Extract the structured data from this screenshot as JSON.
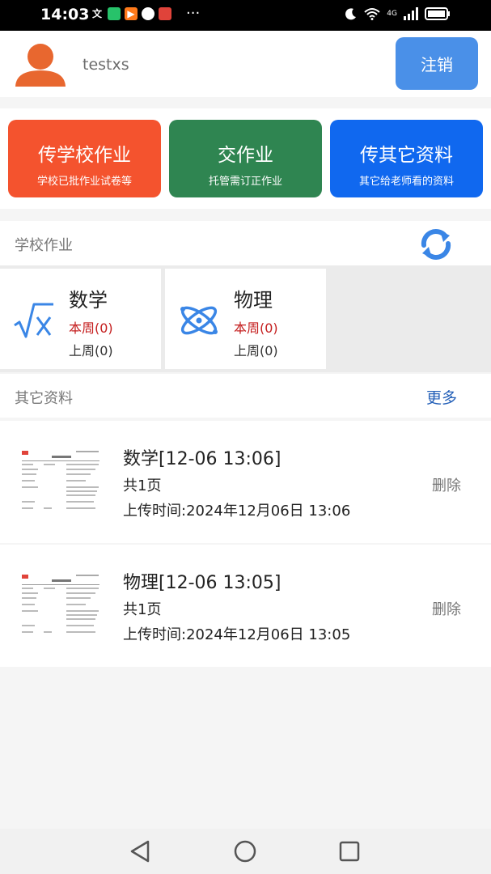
{
  "status_bar": {
    "time": "14:03",
    "notification_icons": [
      "translate-icon",
      "chat-icon",
      "video-icon",
      "browser-icon",
      "book-icon"
    ],
    "more": "···",
    "network_label": "4G"
  },
  "profile": {
    "username": "testxs",
    "logout_label": "注销"
  },
  "actions": [
    {
      "title": "传学校作业",
      "subtitle": "学校已批作业试卷等",
      "color": "#f4532e"
    },
    {
      "title": "交作业",
      "subtitle": "托管需订正作业",
      "color": "#2f8551"
    },
    {
      "title": "传其它资料",
      "subtitle": "其它给老师看的资料",
      "color": "#1068ef"
    }
  ],
  "school_homework": {
    "title": "学校作业",
    "subjects": [
      {
        "name": "数学",
        "this_week": "本周(0)",
        "last_week": "上周(0)",
        "icon": "sqrt-x-icon"
      },
      {
        "name": "物理",
        "this_week": "本周(0)",
        "last_week": "上周(0)",
        "icon": "atom-icon"
      }
    ]
  },
  "other_materials": {
    "title": "其它资料",
    "more_label": "更多",
    "items": [
      {
        "title": "数学[12-06 13:06]",
        "pages": "共1页",
        "upload_time": "上传时间:2024年12月06日 13:06",
        "delete_label": "删除"
      },
      {
        "title": "物理[12-06 13:05]",
        "pages": "共1页",
        "upload_time": "上传时间:2024年12月06日 13:05",
        "delete_label": "删除"
      }
    ]
  },
  "colors": {
    "accent_blue": "#4a90e8",
    "alert_red": "#c41d1d",
    "link_blue": "#2460b8"
  }
}
